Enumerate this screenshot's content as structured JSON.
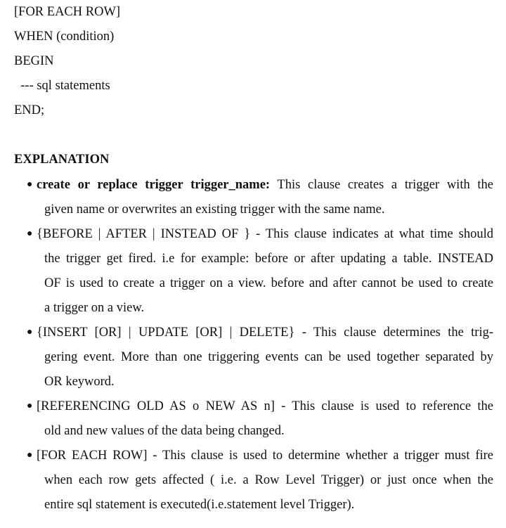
{
  "code": {
    "lines": [
      "[FOR EACH ROW]",
      "WHEN (condition)",
      "BEGIN",
      "  --- sql statements",
      "END;"
    ]
  },
  "explanation": {
    "heading": "EXPLANATION",
    "items": [
      {
        "bold_lead": "create or replace trigger trigger_name:",
        "lines": [
          " This clause creates a trigger with the",
          "given name or overwrites an existing trigger with the same name."
        ]
      },
      {
        "lines": [
          "{BEFORE | AFTER | INSTEAD OF } - This clause indicates at what time should",
          "the trigger get fired. i.e for example: before or after updating a table. INSTEAD",
          "OF is used to create a trigger on a view. before and after cannot be used to create",
          "a trigger on a view."
        ]
      },
      {
        "lines": [
          "{INSERT [OR] | UPDATE [OR] | DELETE} - This clause determines the trig-",
          "gering event. More than one triggering events can be used together separated by",
          "OR keyword."
        ]
      },
      {
        "lines": [
          "[REFERENCING OLD AS o NEW AS n] - This clause is used to reference the",
          "old and new values of the data being changed."
        ]
      },
      {
        "lines": [
          "[FOR EACH ROW] - This clause is used to determine whether a trigger must fire",
          "when each row gets affected ( i.e. a Row Level Trigger) or just once when the",
          "entire sql statement is executed(i.e.statement level Trigger)."
        ]
      }
    ]
  }
}
